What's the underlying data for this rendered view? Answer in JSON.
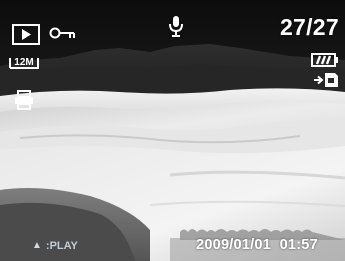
{
  "osd": {
    "play_mode_icon": "play-mode-icon",
    "protect_icon": "key-protect-icon",
    "voice_memo_icon": "microphone-icon",
    "image_counter": "27/27",
    "resolution_label": "12M",
    "battery_icon": "battery-full-icon",
    "copy_to_card_icon": "copy-to-card-icon",
    "dpof_print_icon": "printer-icon",
    "hint_glyph": "▲",
    "hint_label": ":PLAY",
    "date": "2009/01/01",
    "time": "01:57"
  },
  "photo": {
    "description_colors": {
      "sky": "#1c1c1c",
      "mountains": "#2b2b2b",
      "sand": "#e4e4e4"
    }
  }
}
